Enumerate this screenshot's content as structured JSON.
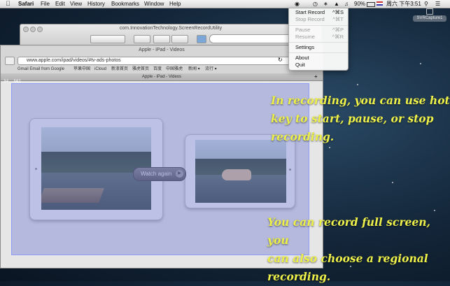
{
  "menubar": {
    "app_name": "Safari",
    "menus": [
      "File",
      "Edit",
      "View",
      "History",
      "Bookmarks",
      "Window",
      "Help"
    ],
    "battery": "90%",
    "clock": "周六 下午3:51"
  },
  "back_window": {
    "title": "com.InnovationTechnology.ScreenRecordUtility"
  },
  "safari": {
    "window_title": "Apple - iPad - Videos",
    "url": "www.apple.com/ipad/videos/#tv-ads-photos",
    "bookmarks": [
      "Gmail Email from Google",
      "苹果中国",
      "iCloud",
      "新浪首页",
      "雅虎首页",
      "百度",
      "中国雅虎",
      "新闻 ▾",
      "流行 ▾"
    ],
    "tab_title": "Apple - iPad - Videos"
  },
  "recording": {
    "coordinate_readout": "34, 561",
    "watch_again_label": "Watch again"
  },
  "status_menu": {
    "items": [
      {
        "label": "Start Record",
        "shortcut": "^⌘S",
        "enabled": true
      },
      {
        "label": "Stop Record",
        "shortcut": "^⌘T",
        "enabled": false
      },
      {
        "label": "Pause",
        "shortcut": "^⌘P",
        "enabled": false
      },
      {
        "label": "Resume",
        "shortcut": "^⌘R",
        "enabled": false
      },
      {
        "label": "Settings",
        "shortcut": "",
        "enabled": true
      },
      {
        "label": "About",
        "shortcut": "",
        "enabled": true
      },
      {
        "label": "Quit",
        "shortcut": "",
        "enabled": true
      }
    ]
  },
  "badge": {
    "label": "SVRCapture1"
  },
  "captions": {
    "hotkey": [
      "In recording, you can use hot",
      "key to start, pause, or stop",
      "recording."
    ],
    "region": [
      "You can record full screen, you",
      "can also choose a regional",
      "recording."
    ]
  },
  "colors": {
    "caption": "#eef04a",
    "region_border": "#8e9cf5"
  }
}
